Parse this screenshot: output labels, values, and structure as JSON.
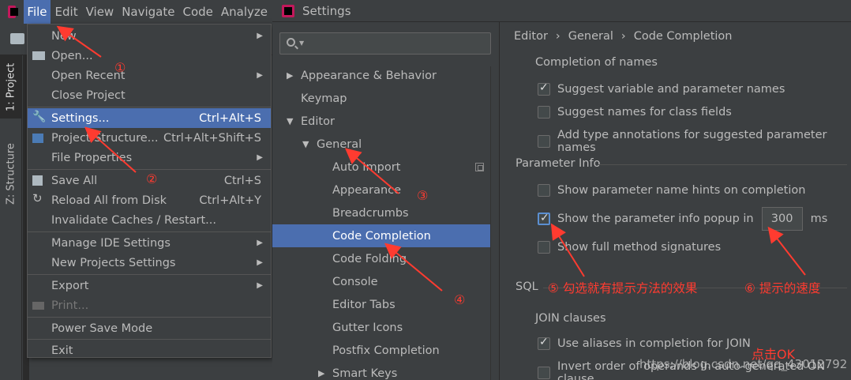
{
  "menubar": {
    "items": [
      "File",
      "Edit",
      "View",
      "Navigate",
      "Code",
      "Analyze"
    ]
  },
  "sidebar": {
    "tabs": [
      "1: Project",
      "Z: Structure"
    ]
  },
  "file_menu": {
    "items": [
      {
        "label": "New",
        "shortcut": "",
        "submenu": true
      },
      {
        "label": "Open...",
        "shortcut": "",
        "submenu": false
      },
      {
        "label": "Open Recent",
        "shortcut": "",
        "submenu": true
      },
      {
        "label": "Close Project",
        "shortcut": "",
        "submenu": false
      },
      {
        "label": "Settings...",
        "shortcut": "Ctrl+Alt+S",
        "submenu": false,
        "selected": true
      },
      {
        "label": "Project Structure...",
        "shortcut": "Ctrl+Alt+Shift+S",
        "submenu": false
      },
      {
        "label": "File Properties",
        "shortcut": "",
        "submenu": true
      },
      {
        "label": "Save All",
        "shortcut": "Ctrl+S",
        "submenu": false
      },
      {
        "label": "Reload All from Disk",
        "shortcut": "Ctrl+Alt+Y",
        "submenu": false
      },
      {
        "label": "Invalidate Caches / Restart...",
        "shortcut": "",
        "submenu": false
      },
      {
        "label": "Manage IDE Settings",
        "shortcut": "",
        "submenu": true
      },
      {
        "label": "New Projects Settings",
        "shortcut": "",
        "submenu": true
      },
      {
        "label": "Export",
        "shortcut": "",
        "submenu": true
      },
      {
        "label": "Print...",
        "shortcut": "",
        "submenu": false,
        "disabled": true
      },
      {
        "label": "Power Save Mode",
        "shortcut": "",
        "submenu": false
      },
      {
        "label": "Exit",
        "shortcut": "",
        "submenu": false
      }
    ]
  },
  "settings": {
    "title": "Settings",
    "tree": [
      {
        "label": "Appearance & Behavior",
        "expanded": false
      },
      {
        "label": "Keymap"
      },
      {
        "label": "Editor",
        "expanded": true
      },
      {
        "label": "General",
        "expanded": true
      },
      {
        "label": "Auto Import"
      },
      {
        "label": "Appearance"
      },
      {
        "label": "Breadcrumbs"
      },
      {
        "label": "Code Completion",
        "selected": true
      },
      {
        "label": "Code Folding"
      },
      {
        "label": "Console"
      },
      {
        "label": "Editor Tabs"
      },
      {
        "label": "Gutter Icons"
      },
      {
        "label": "Postfix Completion"
      },
      {
        "label": "Smart Keys",
        "expanded": false
      }
    ],
    "breadcrumb": [
      "Editor",
      "General",
      "Code Completion"
    ],
    "sections": {
      "completion_of_names": "Completion of names",
      "parameter_info": "Parameter Info",
      "sql": "SQL",
      "join_clauses": "JOIN clauses"
    },
    "options": {
      "suggest_variable": {
        "label": "Suggest variable and parameter names",
        "checked": true
      },
      "suggest_class_fields": {
        "label": "Suggest names for class fields",
        "checked": false
      },
      "add_type_annotations": {
        "label": "Add type annotations for suggested parameter names",
        "checked": false
      },
      "show_hints": {
        "label": "Show parameter name hints on completion",
        "checked": false
      },
      "show_popup": {
        "label": "Show the parameter info popup in",
        "checked": true,
        "value": "300",
        "unit": "ms"
      },
      "show_full_signatures": {
        "label": "Show full method signatures",
        "checked": false
      },
      "use_aliases": {
        "label": "Use aliases in completion for JOIN",
        "checked": true
      },
      "invert_order": {
        "label": "Invert order of operands in auto-generated ON clause",
        "checked": false
      }
    }
  },
  "annotations": {
    "n1": "①",
    "n2": "②",
    "n3": "③",
    "n4": "④",
    "note5": "⑤ 勾选就有提示方法的效果",
    "note6": "⑥ 提示的速度",
    "click_ok": "点击OK",
    "watermark": "https://blog.csdn.net/qq_43012792",
    "color": "#ff3b30"
  }
}
